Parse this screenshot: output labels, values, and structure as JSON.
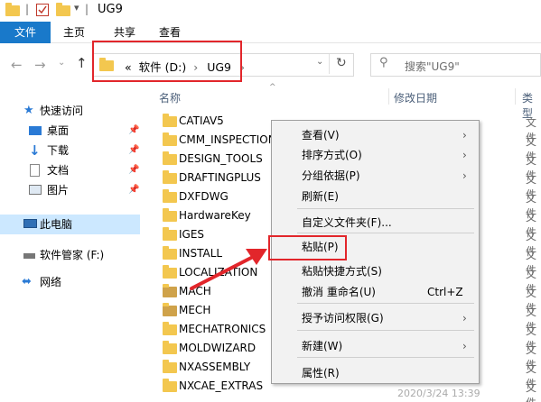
{
  "window": {
    "title": "UG9"
  },
  "ribbon": {
    "tabs": [
      "文件",
      "主页",
      "共享",
      "查看"
    ]
  },
  "address": {
    "crumb_prefix": "«",
    "crumbs": [
      "软件 (D:)",
      "UG9"
    ],
    "separator": "›"
  },
  "search": {
    "placeholder": "搜索\"UG9\""
  },
  "columns": {
    "name": "名称",
    "date": "修改日期",
    "type": "类型"
  },
  "nav": {
    "quick_access": "快速访问",
    "items": [
      "桌面",
      "下载",
      "文档",
      "图片"
    ],
    "this_pc": "此电脑",
    "drive": "软件管家 (F:)",
    "network": "网络"
  },
  "files": [
    "CATIAV5",
    "CMM_INSPECTION",
    "DESIGN_TOOLS",
    "DRAFTINGPLUS",
    "DXFDWG",
    "HardwareKey",
    "IGES",
    "INSTALL",
    "LOCALIZATION",
    "MACH",
    "MECH",
    "MECHATRONICS",
    "MOLDWIZARD",
    "NXASSEMBLY",
    "NXCAE_EXTRAS"
  ],
  "type_label": "文件",
  "bottom_timestamp": "2020/3/24 13:39",
  "context_menu": {
    "items": [
      {
        "label": "查看(V)",
        "submenu": true
      },
      {
        "label": "排序方式(O)",
        "submenu": true
      },
      {
        "label": "分组依据(P)",
        "submenu": true
      },
      {
        "label": "刷新(E)",
        "submenu": false
      },
      {
        "label": "自定义文件夹(F)...",
        "submenu": false
      },
      {
        "label": "粘贴(P)",
        "submenu": false
      },
      {
        "label": "粘贴快捷方式(S)",
        "submenu": false
      },
      {
        "label": "撤消 重命名(U)",
        "submenu": false,
        "shortcut": "Ctrl+Z"
      },
      {
        "label": "授予访问权限(G)",
        "submenu": true
      },
      {
        "label": "新建(W)",
        "submenu": true
      },
      {
        "label": "属性(R)",
        "submenu": false
      }
    ]
  },
  "colors": {
    "accent": "#1979ca",
    "highlight_red": "#e2262b",
    "folder": "#f3c74f",
    "selection": "#cce8ff"
  }
}
